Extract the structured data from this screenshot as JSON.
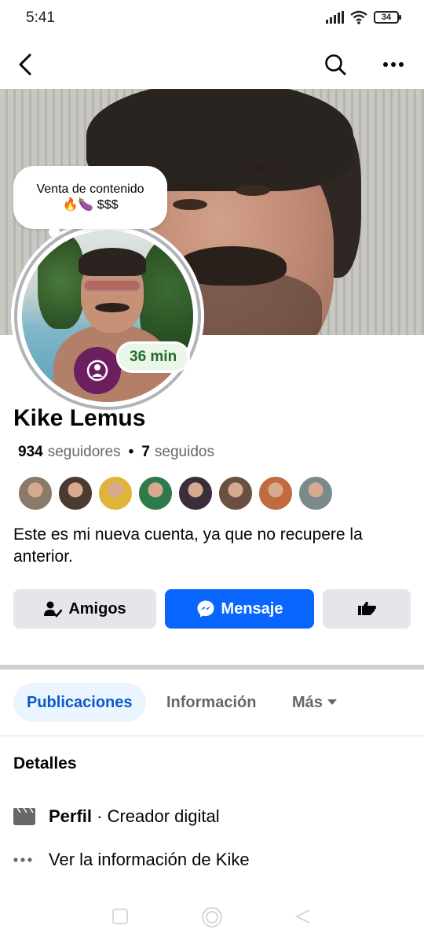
{
  "status_bar": {
    "time": "5:41",
    "battery": "34"
  },
  "nav": {
    "back_icon": "arrow-left-icon",
    "search_icon": "search-icon",
    "more_icon": "more-dots-icon"
  },
  "note": {
    "line1": "Venta de contenido",
    "line2": "🔥🍆 $$$"
  },
  "avatar": {
    "story_time": "36 min"
  },
  "profile": {
    "name": "Kike Lemus",
    "followers_count": "934",
    "followers_label": "seguidores",
    "separator": "•",
    "following_count": "7",
    "following_label": "seguidos",
    "bio": "Este es mi nueva cuenta, ya que no recupere la anterior."
  },
  "friends": [
    {
      "color": "#8a7a6a"
    },
    {
      "color": "#4a3a30"
    },
    {
      "color": "#e0b43a"
    },
    {
      "color": "#2f7a4a"
    },
    {
      "color": "#3a2e3a"
    },
    {
      "color": "#6a5040"
    },
    {
      "color": "#c06a40"
    },
    {
      "color": "#7a8a8a"
    }
  ],
  "actions": {
    "friends_label": "Amigos",
    "message_label": "Mensaje"
  },
  "tabs": {
    "posts": "Publicaciones",
    "info": "Información",
    "more": "Más"
  },
  "details": {
    "title": "Detalles",
    "profile_strong": "Perfil",
    "profile_rest": " · Creador digital",
    "see_info": "Ver la información de Kike"
  },
  "colors": {
    "accent": "#0866ff",
    "tab_active_bg": "#ebf5ff",
    "story_badge": "#eaf6e8"
  }
}
